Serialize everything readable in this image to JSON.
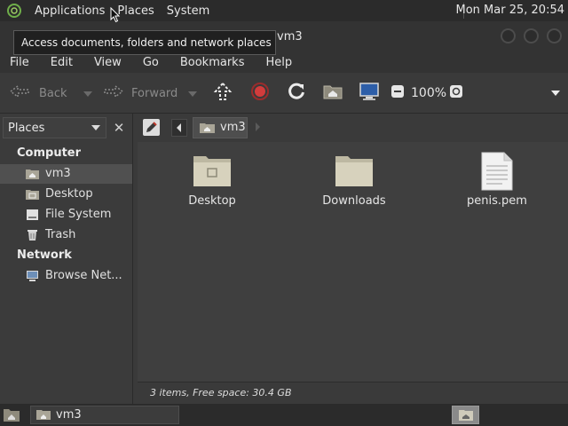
{
  "top_panel": {
    "menus": [
      "Applications",
      "Places",
      "System"
    ],
    "clock": "Mon Mar 25, 20:54"
  },
  "tooltip": "Access documents, folders and network places",
  "window": {
    "title": "vm3"
  },
  "menubar": [
    "File",
    "Edit",
    "View",
    "Go",
    "Bookmarks",
    "Help"
  ],
  "toolbar": {
    "back": "Back",
    "forward": "Forward",
    "zoom": "100%"
  },
  "sidebar": {
    "selector": "Places",
    "computer_heading": "Computer",
    "computer_items": [
      "vm3",
      "Desktop",
      "File System",
      "Trash"
    ],
    "network_heading": "Network",
    "network_items": [
      "Browse Net..."
    ],
    "selected": "vm3"
  },
  "location": {
    "crumb": "vm3"
  },
  "files": [
    {
      "name": "Desktop",
      "icon": "desktop-folder-icon"
    },
    {
      "name": "Downloads",
      "icon": "folder-icon"
    },
    {
      "name": "penis.pem",
      "icon": "text-file-icon"
    }
  ],
  "status": "3 items, Free space: 30.4 GB",
  "taskbar": {
    "window_label": "vm3"
  },
  "colors": {
    "panel": "#2b2b2b",
    "window": "#3a3a3a",
    "content": "#3f3f3f",
    "stop": "#d23c3c",
    "folder": "#c9c3aa"
  }
}
